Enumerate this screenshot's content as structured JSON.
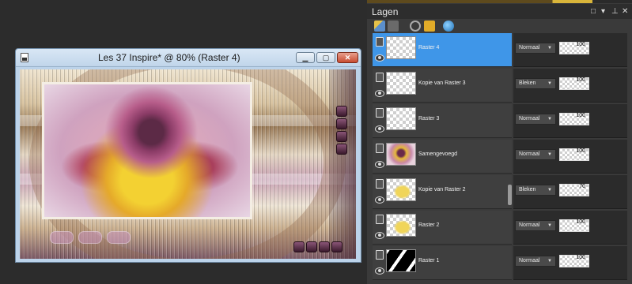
{
  "window": {
    "title": "Les 37 Inspire* @  80% (Raster 4)",
    "minimize_label": "▁",
    "maximize_label": "▢",
    "close_label": "✕"
  },
  "layers_panel": {
    "title": "Lagen",
    "header_buttons": [
      "□",
      "▾",
      "⊥",
      "✕"
    ],
    "layers": [
      {
        "name": "Raster 4",
        "blend": "Normaal",
        "opacity": "100",
        "thumb": "empty",
        "selected": true
      },
      {
        "name": "Kopie van Raster 3",
        "blend": "Bleken",
        "opacity": "100",
        "thumb": "empty",
        "selected": false
      },
      {
        "name": "Raster 3",
        "blend": "Normaal",
        "opacity": "100",
        "thumb": "empty",
        "selected": false
      },
      {
        "name": "Samengevoegd",
        "blend": "Normaal",
        "opacity": "100",
        "thumb": "merged",
        "selected": false
      },
      {
        "name": "Kopie van Raster 2",
        "blend": "Bleken",
        "opacity": "70",
        "thumb": "yellow",
        "selected": false
      },
      {
        "name": "Raster 2",
        "blend": "Normaal",
        "opacity": "100",
        "thumb": "yellow",
        "selected": false
      },
      {
        "name": "Raster 1",
        "blend": "Normaal",
        "opacity": "100",
        "thumb": "stripes",
        "selected": false
      }
    ]
  },
  "colors": {
    "selected_row": "#3f96e8",
    "panel_bg": "#3a3a3a",
    "workspace_bg": "#2c2c2c"
  }
}
